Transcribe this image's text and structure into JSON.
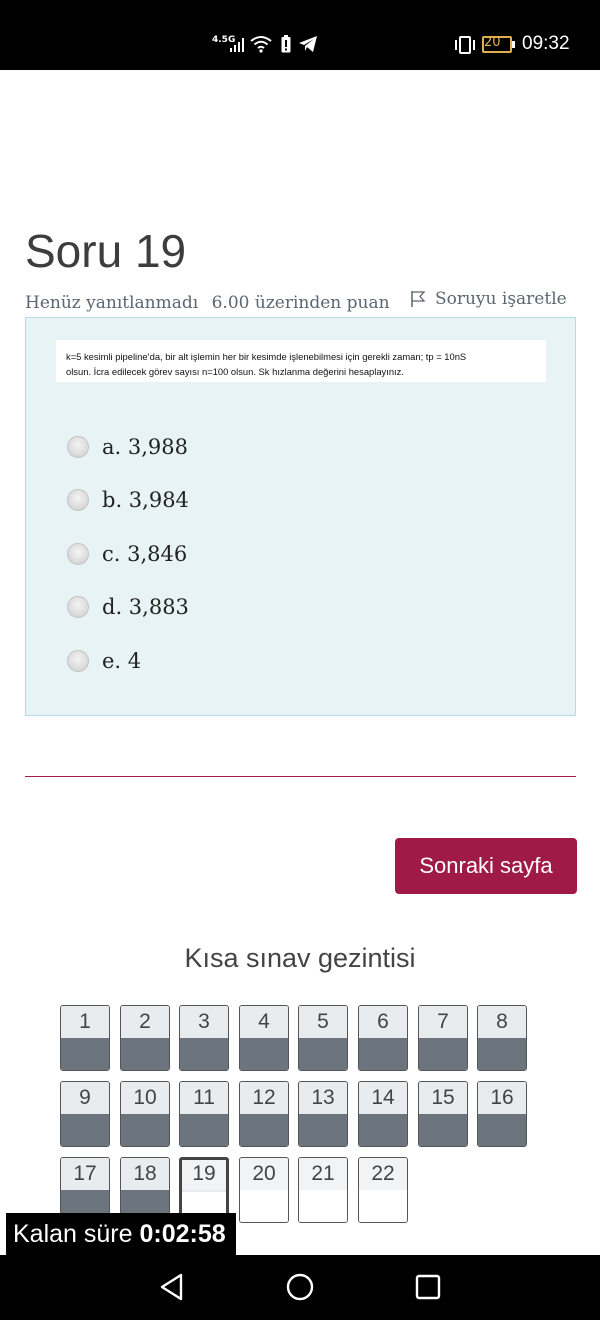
{
  "status_bar": {
    "network": "4.5G",
    "battery_level": "20",
    "time": "09:32"
  },
  "question": {
    "title": "Soru 19",
    "status": "Henüz yanıtlanmadı",
    "points": "6.00 üzerinden puan",
    "flag_label": "Soruyu işaretle",
    "text_line1": "k=5 kesimli pipeline’da, bir alt işlemin her bir kesimde işlenebilmesi için gerekli zaman; tp = 10nS",
    "text_line2": "olsun. İcra edilecek görev sayısı  n=100 olsun. Sk hızlanma değerini hesaplayınız.",
    "answers": [
      {
        "label": "a. 3,988"
      },
      {
        "label": "b. 3,984"
      },
      {
        "label": "c. 3,846"
      },
      {
        "label": "d. 3,883"
      },
      {
        "label": "e. 4"
      }
    ]
  },
  "next_button": "Sonraki sayfa",
  "quiz_nav": {
    "title": "Kısa sınav gezintisi",
    "buttons": [
      "1",
      "2",
      "3",
      "4",
      "5",
      "6",
      "7",
      "8",
      "9",
      "10",
      "11",
      "12",
      "13",
      "14",
      "15",
      "16",
      "17",
      "18",
      "19",
      "20",
      "21",
      "22"
    ],
    "current": "19"
  },
  "timer": {
    "label": "Kalan süre",
    "value": "0:02:58"
  },
  "colors": {
    "brand": "#a01a47",
    "answered": "#6c757d",
    "question_bg": "#e7f3f5"
  }
}
